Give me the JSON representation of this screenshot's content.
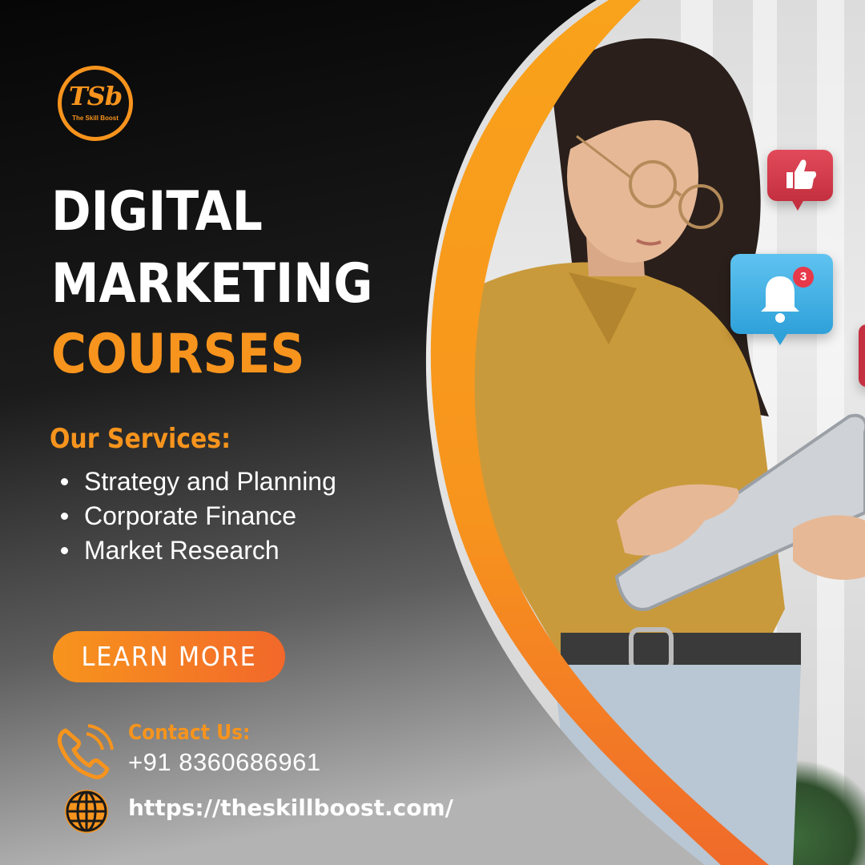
{
  "brand": {
    "logo_mark": "TSb",
    "logo_text": "The Skill Boost"
  },
  "headline": {
    "line1": "DIGITAL",
    "line2": "MARKETING",
    "line3": "COURSES"
  },
  "services": {
    "heading": "Our Services:",
    "items": [
      "Strategy and Planning",
      "Corporate Finance",
      "Market Research"
    ]
  },
  "cta": {
    "label": "LEARN MORE"
  },
  "contact": {
    "label": "Contact Us:",
    "phone": "+91 8360686961",
    "website": "https://theskillboost.com/"
  },
  "notifications": {
    "bell_count": "3"
  },
  "colors": {
    "accent": "#f7941d",
    "accent_dark": "#f2682a",
    "panel": "#0b0b0b",
    "like_red": "#c4303f",
    "bell_blue": "#2fa1d9"
  },
  "icons": [
    "phone-icon",
    "globe-icon",
    "thumbs-up-icon",
    "bell-icon"
  ]
}
